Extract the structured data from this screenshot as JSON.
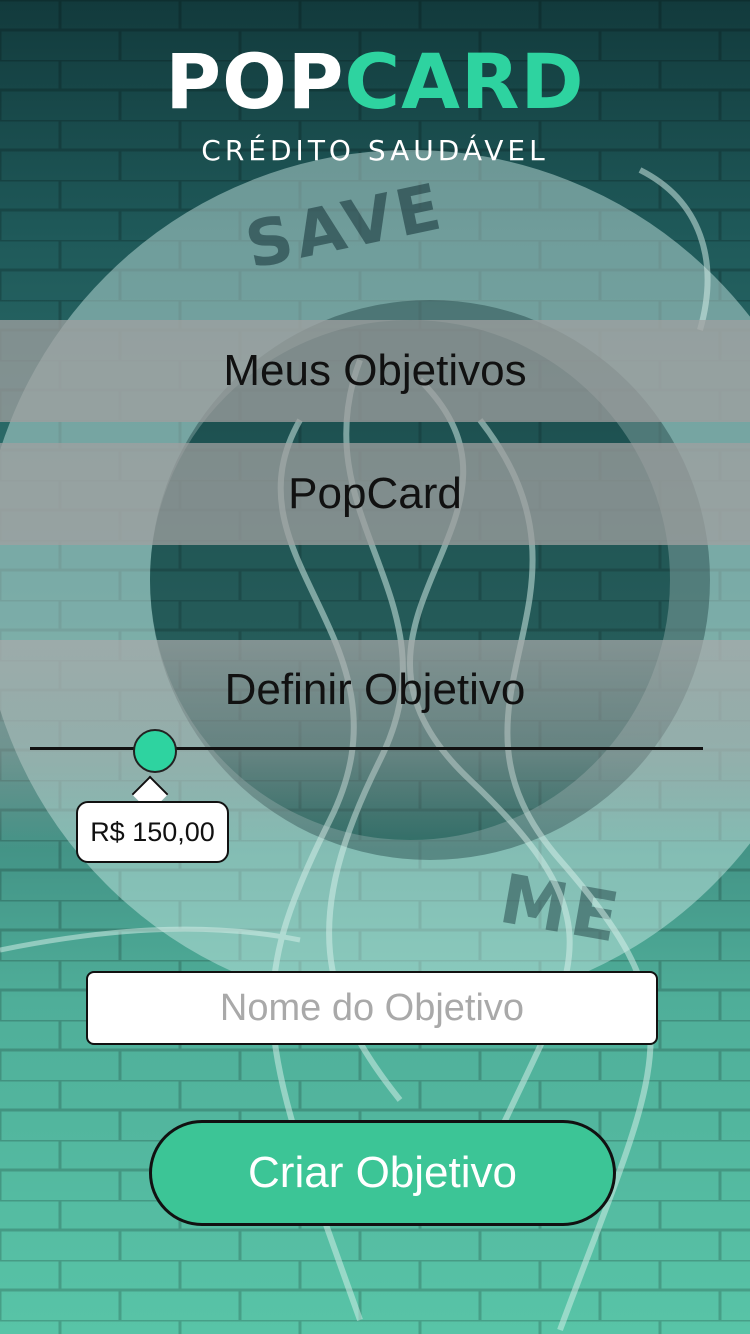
{
  "brand": {
    "logo_part1": "POP",
    "logo_part2": "CARD",
    "tagline": "CRÉDITO SAUDÁVEL"
  },
  "menu": {
    "item1": "Meus Objetivos",
    "item2": "PopCard"
  },
  "goal": {
    "title": "Definir Objetivo",
    "amount_label": "R$ 150,00",
    "slider_fraction": 0.18
  },
  "form": {
    "name_placeholder": "Nome do Objetivo",
    "name_value": ""
  },
  "actions": {
    "create_label": "Criar Objetivo"
  },
  "colors": {
    "accent": "#2ed3a0",
    "button": "#3cc596"
  }
}
